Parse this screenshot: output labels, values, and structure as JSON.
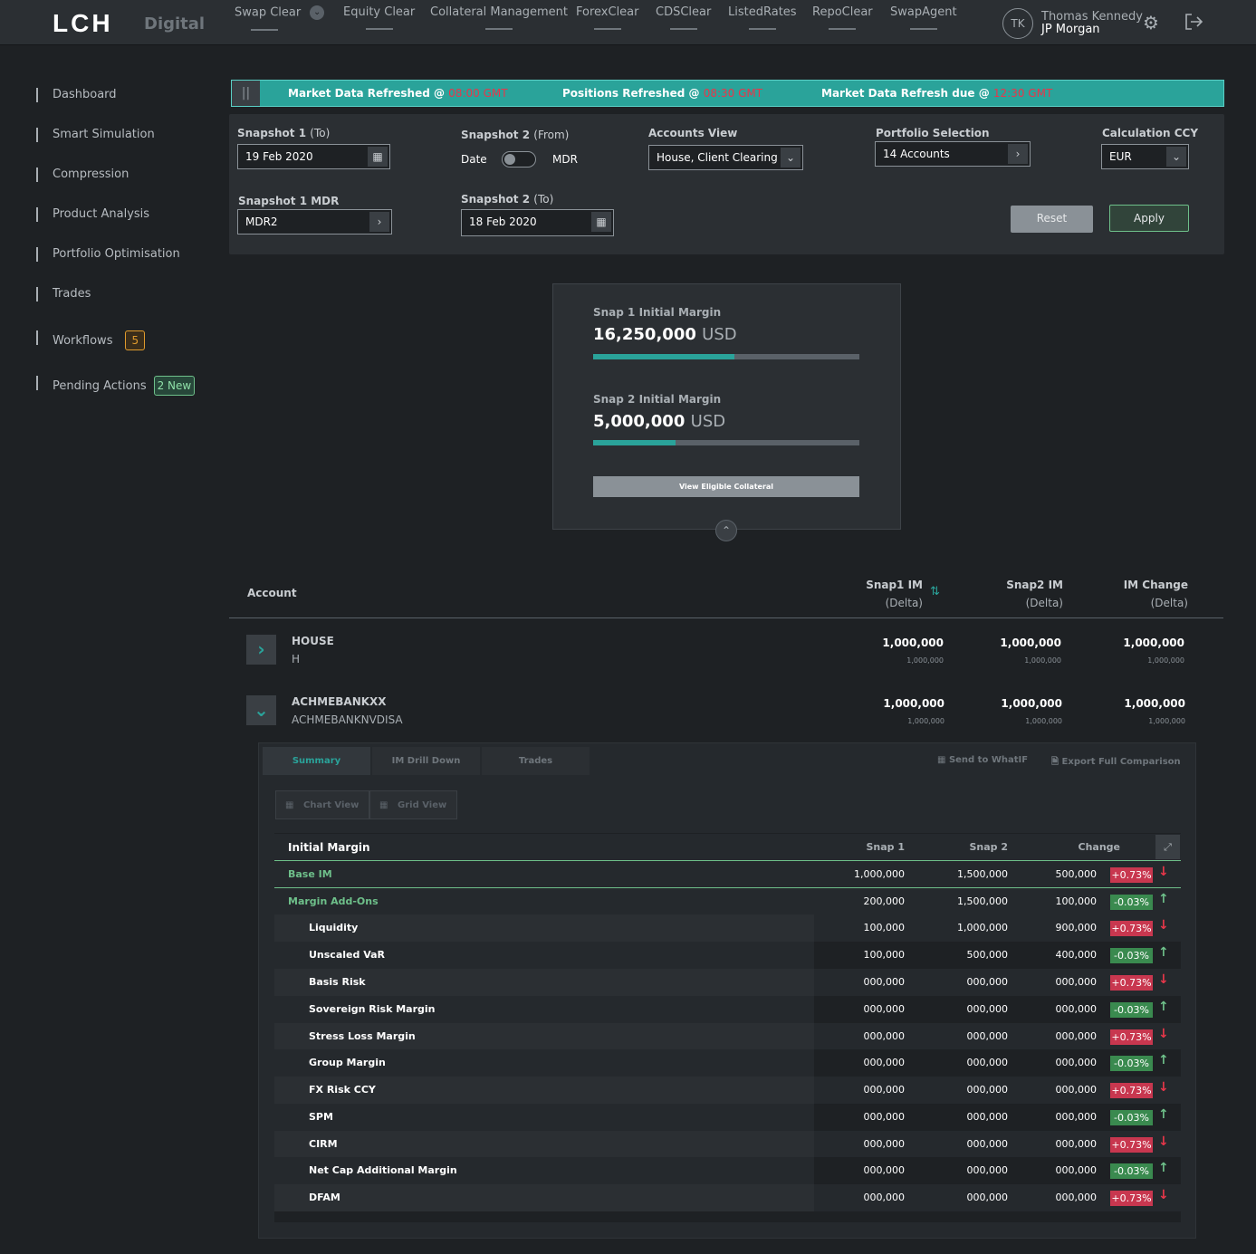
{
  "header": {
    "logo": "LCH",
    "logo_sub": "Digital",
    "nav": [
      "Swap Clear",
      "Equity Clear",
      "Collateral Management",
      "ForexClear",
      "CDSClear",
      "ListedRates",
      "RepoClear",
      "SwapAgent"
    ],
    "user_initials": "TK",
    "user_name": "Thomas Kennedy",
    "user_company": "JP Morgan"
  },
  "sidebar": {
    "items": [
      {
        "label": "Dashboard"
      },
      {
        "label": "Smart Simulation"
      },
      {
        "label": "Compression"
      },
      {
        "label": "Product Analysis"
      },
      {
        "label": "Portfolio Optimisation"
      },
      {
        "label": "Trades"
      },
      {
        "label": "Workflows",
        "badge": "5"
      },
      {
        "label": "Pending Actions",
        "badge": "2 New"
      }
    ]
  },
  "ticker": {
    "items": [
      {
        "label": "Market Data Refreshed @ ",
        "time": "08:00 GMT"
      },
      {
        "label": "Positions Refreshed @ ",
        "time": "08:30 GMT"
      },
      {
        "label": "Market Data Refresh due @ ",
        "time": "12:30 GMT"
      }
    ]
  },
  "filters": {
    "snap1_label": "Snapshot 1",
    "snap1_suffix": "(To)",
    "snap1_date": "19 Feb 2020",
    "snap2_label": "Snapshot 2",
    "snap2_from_suffix": "(From)",
    "toggle_left": "Date",
    "toggle_right": "MDR",
    "accounts_view_label": "Accounts View",
    "accounts_view_value": "House, Client Clearing",
    "portfolio_label": "Portfolio Selection",
    "portfolio_value": "14 Accounts",
    "ccy_label": "Calculation CCY",
    "ccy_value": "EUR",
    "snap1_mdr_label": "Snapshot 1 MDR",
    "snap1_mdr_value": "MDR2",
    "snap2_to_label": "Snapshot 2",
    "snap2_to_suffix": "(To)",
    "snap2_date": "18 Feb 2020",
    "reset": "Reset",
    "apply": "Apply"
  },
  "summary_card": {
    "snap1_label": "Snap 1 Initial Margin",
    "snap1_value": "16,250,000",
    "snap1_unit": "USD",
    "snap1_fill": 0.53,
    "snap2_label": "Snap 2 Initial Margin",
    "snap2_value": "5,000,000",
    "snap2_unit": "USD",
    "snap2_fill": 0.31,
    "button": "View Eligible Collateral"
  },
  "table": {
    "col_account": "Account",
    "col_snap1": "Snap1 IM",
    "col_snap2": "Snap2 IM",
    "col_change": "IM Change",
    "col_delta": "(Delta)",
    "accounts": [
      {
        "name": "HOUSE",
        "sub": "H",
        "s1": "1,000,000",
        "s1d": "1,000,000",
        "s2": "1,000,000",
        "s2d": "1,000,000",
        "c": "1,000,000",
        "cd": "1,000,000"
      },
      {
        "name": "ACHMEBANKXX",
        "sub": "ACHMEBANKNVDISA",
        "s1": "1,000,000",
        "s1d": "1,000,000",
        "s2": "1,000,000",
        "s2d": "1,000,000",
        "c": "1,000,000",
        "cd": "1,000,000"
      }
    ]
  },
  "detail": {
    "tabs": [
      "Summary",
      "IM Drill Down",
      "Trades"
    ],
    "send": "Send to WhatIF",
    "export": "Export Full Comparison",
    "chart_view": "Chart View",
    "grid_view": "Grid View",
    "grid_title": "Initial Margin",
    "grid_snap1": "Snap 1",
    "grid_snap2": "Snap 2",
    "grid_change": "Change",
    "rows": [
      {
        "name": "Base IM",
        "s1": "1,000,000",
        "s2": "1,500,000",
        "c": "500,000",
        "pct": "+0.73%",
        "dir": "up",
        "group": true
      },
      {
        "name": "Margin Add-Ons",
        "s1": "200,000",
        "s2": "1,500,000",
        "c": "100,000",
        "pct": "-0.03%",
        "dir": "down",
        "group": true
      },
      {
        "name": "Liquidity",
        "s1": "100,000",
        "s2": "1,000,000",
        "c": "900,000",
        "pct": "+0.73%",
        "dir": "up"
      },
      {
        "name": "Unscaled VaR",
        "s1": "100,000",
        "s2": "500,000",
        "c": "400,000",
        "pct": "-0.03%",
        "dir": "down"
      },
      {
        "name": "Basis Risk",
        "s1": "000,000",
        "s2": "000,000",
        "c": "000,000",
        "pct": "+0.73%",
        "dir": "up"
      },
      {
        "name": "Sovereign Risk Margin",
        "s1": "000,000",
        "s2": "000,000",
        "c": "000,000",
        "pct": "-0.03%",
        "dir": "down"
      },
      {
        "name": "Stress Loss Margin",
        "s1": "000,000",
        "s2": "000,000",
        "c": "000,000",
        "pct": "+0.73%",
        "dir": "up"
      },
      {
        "name": "Group Margin",
        "s1": "000,000",
        "s2": "000,000",
        "c": "000,000",
        "pct": "-0.03%",
        "dir": "down"
      },
      {
        "name": "FX Risk CCY",
        "s1": "000,000",
        "s2": "000,000",
        "c": "000,000",
        "pct": "+0.73%",
        "dir": "up"
      },
      {
        "name": "SPM",
        "s1": "000,000",
        "s2": "000,000",
        "c": "000,000",
        "pct": "-0.03%",
        "dir": "down"
      },
      {
        "name": "CIRM",
        "s1": "000,000",
        "s2": "000,000",
        "c": "000,000",
        "pct": "+0.73%",
        "dir": "up"
      },
      {
        "name": "Net Cap Additional Margin",
        "s1": "000,000",
        "s2": "000,000",
        "c": "000,000",
        "pct": "-0.03%",
        "dir": "down"
      },
      {
        "name": "DFAM",
        "s1": "000,000",
        "s2": "000,000",
        "c": "000,000",
        "pct": "+0.73%",
        "dir": "up"
      }
    ]
  }
}
